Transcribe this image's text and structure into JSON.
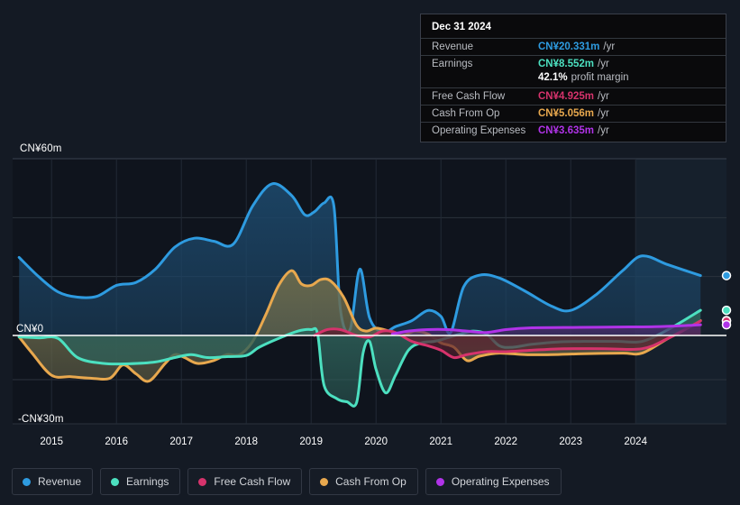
{
  "chart_data": {
    "type": "area",
    "title": "",
    "xlabel": "",
    "ylabel": "",
    "currency": "CN¥",
    "grid": true,
    "legend_position": "bottom",
    "ylim": [
      -30,
      60
    ],
    "y_ticks": [
      {
        "value": 60,
        "label": "CN¥60m"
      },
      {
        "value": 0,
        "label": "CN¥0"
      },
      {
        "value": -30,
        "label": "-CN¥30m"
      }
    ],
    "x_ticks": [
      "2015",
      "2016",
      "2017",
      "2018",
      "2019",
      "2020",
      "2021",
      "2022",
      "2023",
      "2024"
    ],
    "x_range": [
      "2014.4",
      "2025.4"
    ],
    "forecast_start": "2024.0",
    "series": [
      {
        "name": "Revenue",
        "color": "#2e9be0",
        "fill": "#1c4566",
        "points": [
          [
            2014.5,
            26.5
          ],
          [
            2014.8,
            20.0
          ],
          [
            2015.1,
            14.8
          ],
          [
            2015.4,
            13.0
          ],
          [
            2015.7,
            13.3
          ],
          [
            2016.0,
            17.0
          ],
          [
            2016.3,
            18.0
          ],
          [
            2016.6,
            22.5
          ],
          [
            2016.9,
            30.0
          ],
          [
            2017.2,
            33.0
          ],
          [
            2017.5,
            32.0
          ],
          [
            2017.8,
            31.0
          ],
          [
            2018.1,
            44.0
          ],
          [
            2018.4,
            51.5
          ],
          [
            2018.7,
            47.5
          ],
          [
            2018.9,
            41.0
          ],
          [
            2019.05,
            42.0
          ],
          [
            2019.2,
            45.0
          ],
          [
            2019.35,
            44.0
          ],
          [
            2019.45,
            9.0
          ],
          [
            2019.6,
            2.0
          ],
          [
            2019.75,
            22.5
          ],
          [
            2019.9,
            6.0
          ],
          [
            2020.1,
            1.0
          ],
          [
            2020.3,
            3.0
          ],
          [
            2020.55,
            5.0
          ],
          [
            2020.8,
            8.5
          ],
          [
            2021.0,
            6.5
          ],
          [
            2021.15,
            1.0
          ],
          [
            2021.35,
            16.5
          ],
          [
            2021.6,
            20.5
          ],
          [
            2021.9,
            19.5
          ],
          [
            2022.3,
            15.0
          ],
          [
            2022.7,
            10.0
          ],
          [
            2023.0,
            8.5
          ],
          [
            2023.4,
            14.0
          ],
          [
            2023.8,
            22.0
          ],
          [
            2024.1,
            27.0
          ],
          [
            2024.5,
            24.0
          ],
          [
            2025.0,
            20.331
          ]
        ]
      },
      {
        "name": "Earnings",
        "color": "#4ce0c0",
        "fill": "#2d5f58",
        "points": [
          [
            2014.5,
            -0.5
          ],
          [
            2014.8,
            -0.8
          ],
          [
            2015.1,
            -1.0
          ],
          [
            2015.4,
            -7.5
          ],
          [
            2015.8,
            -9.5
          ],
          [
            2016.2,
            -9.6
          ],
          [
            2016.6,
            -9.0
          ],
          [
            2016.9,
            -7.5
          ],
          [
            2017.15,
            -6.5
          ],
          [
            2017.4,
            -7.5
          ],
          [
            2017.7,
            -7.2
          ],
          [
            2018.0,
            -6.8
          ],
          [
            2018.2,
            -4.0
          ],
          [
            2018.5,
            -1.0
          ],
          [
            2018.8,
            1.5
          ],
          [
            2019.0,
            2.0
          ],
          [
            2019.1,
            0.5
          ],
          [
            2019.2,
            -17.0
          ],
          [
            2019.4,
            -21.5
          ],
          [
            2019.55,
            -22.5
          ],
          [
            2019.7,
            -22.8
          ],
          [
            2019.8,
            -6.0
          ],
          [
            2019.9,
            -2.0
          ],
          [
            2020.0,
            -11.5
          ],
          [
            2020.15,
            -19.5
          ],
          [
            2020.3,
            -13.5
          ],
          [
            2020.5,
            -5.0
          ],
          [
            2020.7,
            -2.5
          ],
          [
            2020.9,
            -2.0
          ],
          [
            2021.1,
            -0.8
          ],
          [
            2021.3,
            0.5
          ],
          [
            2021.5,
            1.5
          ],
          [
            2021.7,
            0.5
          ],
          [
            2021.9,
            -3.5
          ],
          [
            2022.1,
            -4.0
          ],
          [
            2022.4,
            -3.0
          ],
          [
            2022.8,
            -2.2
          ],
          [
            2023.2,
            -2.0
          ],
          [
            2023.7,
            -2.0
          ],
          [
            2024.1,
            -2.0
          ],
          [
            2024.5,
            2.0
          ],
          [
            2025.0,
            8.552
          ]
        ]
      },
      {
        "name": "Free Cash Flow",
        "color": "#d6336c",
        "fill": "#5a2030",
        "points": [
          [
            2019.05,
            0.0
          ],
          [
            2019.25,
            2.0
          ],
          [
            2019.45,
            2.0
          ],
          [
            2019.7,
            0.0
          ],
          [
            2019.9,
            -0.5
          ],
          [
            2020.1,
            1.5
          ],
          [
            2020.3,
            1.0
          ],
          [
            2020.55,
            -2.0
          ],
          [
            2020.8,
            -3.5
          ],
          [
            2021.0,
            -5.0
          ],
          [
            2021.2,
            -7.5
          ],
          [
            2021.4,
            -6.5
          ],
          [
            2021.7,
            -5.5
          ],
          [
            2022.0,
            -5.5
          ],
          [
            2022.4,
            -5.0
          ],
          [
            2022.9,
            -4.5
          ],
          [
            2023.5,
            -4.5
          ],
          [
            2024.1,
            -4.5
          ],
          [
            2024.5,
            -1.0
          ],
          [
            2025.0,
            4.925
          ]
        ]
      },
      {
        "name": "Cash From Op",
        "color": "#e8a84e",
        "fill": "#6b6a4c",
        "points": [
          [
            2014.5,
            -0.5
          ],
          [
            2014.7,
            -6.0
          ],
          [
            2015.0,
            -13.5
          ],
          [
            2015.3,
            -14.0
          ],
          [
            2015.6,
            -14.5
          ],
          [
            2015.9,
            -14.5
          ],
          [
            2016.1,
            -10.0
          ],
          [
            2016.3,
            -13.0
          ],
          [
            2016.5,
            -15.5
          ],
          [
            2016.75,
            -9.5
          ],
          [
            2016.9,
            -6.5
          ],
          [
            2017.05,
            -7.5
          ],
          [
            2017.25,
            -9.5
          ],
          [
            2017.5,
            -8.5
          ],
          [
            2017.7,
            -6.5
          ],
          [
            2017.9,
            -6.5
          ],
          [
            2018.1,
            -2.0
          ],
          [
            2018.3,
            7.0
          ],
          [
            2018.5,
            17.0
          ],
          [
            2018.7,
            22.0
          ],
          [
            2018.85,
            17.5
          ],
          [
            2019.0,
            17.0
          ],
          [
            2019.15,
            19.0
          ],
          [
            2019.3,
            18.5
          ],
          [
            2019.5,
            13.0
          ],
          [
            2019.7,
            3.5
          ],
          [
            2019.85,
            1.5
          ],
          [
            2020.0,
            2.5
          ],
          [
            2020.2,
            1.5
          ],
          [
            2020.4,
            0.0
          ],
          [
            2020.6,
            1.5
          ],
          [
            2020.8,
            0.5
          ],
          [
            2021.0,
            -2.5
          ],
          [
            2021.2,
            -4.0
          ],
          [
            2021.4,
            -8.5
          ],
          [
            2021.6,
            -7.0
          ],
          [
            2021.9,
            -6.0
          ],
          [
            2022.3,
            -6.5
          ],
          [
            2022.7,
            -6.5
          ],
          [
            2023.2,
            -6.2
          ],
          [
            2023.8,
            -6.0
          ],
          [
            2024.1,
            -6.0
          ],
          [
            2024.5,
            -1.0
          ],
          [
            2025.0,
            5.056
          ]
        ]
      },
      {
        "name": "Operating Expenses",
        "color": "#b033e8",
        "fill": "#4b2b6b",
        "points": [
          [
            2020.25,
            0.5
          ],
          [
            2020.5,
            1.5
          ],
          [
            2020.8,
            2.0
          ],
          [
            2021.1,
            2.0
          ],
          [
            2021.4,
            1.5
          ],
          [
            2021.7,
            1.0
          ],
          [
            2022.0,
            2.0
          ],
          [
            2022.4,
            2.6
          ],
          [
            2022.9,
            2.7
          ],
          [
            2023.4,
            2.8
          ],
          [
            2023.9,
            2.9
          ],
          [
            2024.3,
            3.0
          ],
          [
            2024.7,
            3.3
          ],
          [
            2025.0,
            3.635
          ]
        ]
      }
    ],
    "endpoint_markers": [
      {
        "series": "Revenue",
        "value": 20.331
      },
      {
        "series": "Earnings",
        "value": 8.552
      },
      {
        "series": "Cash From Op",
        "value": 5.056
      },
      {
        "series": "Free Cash Flow",
        "value": 4.925
      },
      {
        "series": "Operating Expenses",
        "value": 3.635
      }
    ]
  },
  "tooltip": {
    "date": "Dec 31 2024",
    "rows": [
      {
        "label": "Revenue",
        "value": "CN¥20.331m",
        "unit": "/yr",
        "color": "#2e9be0"
      },
      {
        "label": "Earnings",
        "value": "CN¥8.552m",
        "unit": "/yr",
        "color": "#4ce0c0"
      },
      {
        "label": "",
        "margin_value": "42.1%",
        "margin_text": "profit margin"
      },
      {
        "label": "Free Cash Flow",
        "value": "CN¥4.925m",
        "unit": "/yr",
        "color": "#d6336c"
      },
      {
        "label": "Cash From Op",
        "value": "CN¥5.056m",
        "unit": "/yr",
        "color": "#e8a84e"
      },
      {
        "label": "Operating Expenses",
        "value": "CN¥3.635m",
        "unit": "/yr",
        "color": "#b033e8"
      }
    ]
  },
  "legend": {
    "items": [
      {
        "label": "Revenue",
        "color": "#2e9be0"
      },
      {
        "label": "Earnings",
        "color": "#4ce0c0"
      },
      {
        "label": "Free Cash Flow",
        "color": "#d6336c"
      },
      {
        "label": "Cash From Op",
        "color": "#e8a84e"
      },
      {
        "label": "Operating Expenses",
        "color": "#b033e8"
      }
    ]
  },
  "axis": {
    "y_top": "CN¥60m",
    "y_zero": "CN¥0",
    "y_bottom": "-CN¥30m"
  }
}
